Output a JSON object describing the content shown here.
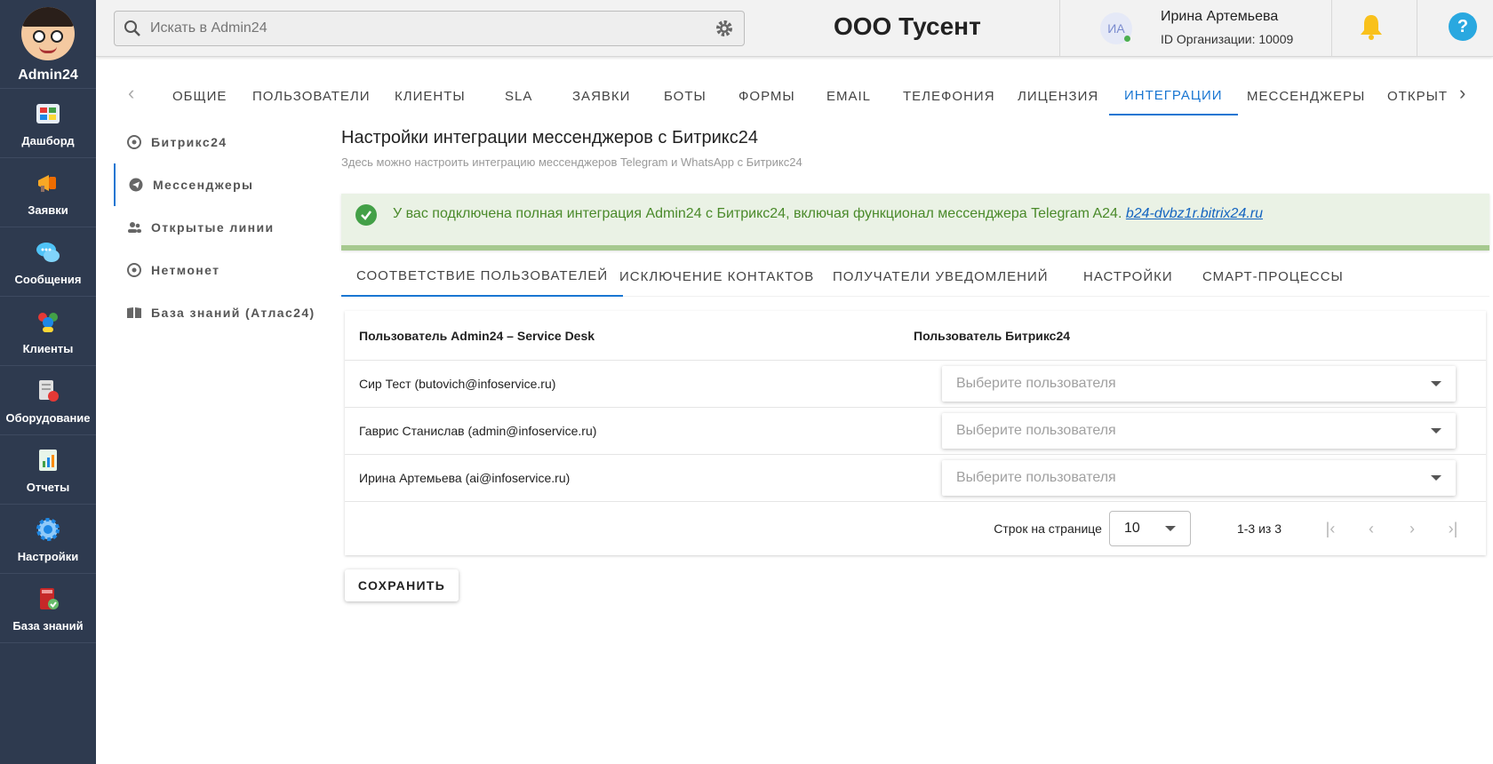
{
  "brand": {
    "name": "Admin24"
  },
  "sidebar": {
    "items": [
      {
        "label": "Дашборд",
        "icon": "dashboard-icon"
      },
      {
        "label": "Заявки",
        "icon": "megaphone-icon"
      },
      {
        "label": "Сообщения",
        "icon": "chat-bubbles-icon"
      },
      {
        "label": "Клиенты",
        "icon": "people-icon"
      },
      {
        "label": "Оборудование",
        "icon": "equipment-icon"
      },
      {
        "label": "Отчеты",
        "icon": "report-icon"
      },
      {
        "label": "Настройки",
        "icon": "gear-icon"
      },
      {
        "label": "База знаний",
        "icon": "book-icon"
      }
    ]
  },
  "header": {
    "search_placeholder": "Искать в Admin24",
    "org_title": "ООО Тусент",
    "user_initials": "ИА",
    "user_name": "Ирина Артемьева",
    "org_id": "ID Организации: 10009"
  },
  "main_tabs": [
    "Общие",
    "Пользователи",
    "Клиенты",
    "SLA",
    "Заявки",
    "Боты",
    "Формы",
    "Email",
    "Телефония",
    "Лицензия",
    "Интеграции",
    "Мессенджеры",
    "Открыт"
  ],
  "main_tabs_active": "Интеграции",
  "subnav": [
    {
      "label": "Битрикс24",
      "icon": "bitrix-icon"
    },
    {
      "label": "Мессенджеры",
      "icon": "telegram-icon"
    },
    {
      "label": "Открытые линии",
      "icon": "group-icon"
    },
    {
      "label": "Нетмонет",
      "icon": "bitrix-icon"
    },
    {
      "label": "База знаний (Атлас24)",
      "icon": "book-open-icon"
    }
  ],
  "content": {
    "title": "Настройки интеграции мессенджеров с Битрикс24",
    "subtitle": "Здесь можно настроить интеграцию мессенджеров Telegram и WhatsApp с Битрикс24",
    "alert_text": "У вас подключена полная интеграция Admin24 с Битрикс24, включая функционал мессенджера Telegram A24.",
    "alert_link": "b24-dvbz1r.bitrix24.ru",
    "sub_tabs": [
      "Соответствие пользователей",
      "Исключение контактов",
      "Получатели уведомлений",
      "Настройки",
      "Смарт-процессы"
    ],
    "table": {
      "col1": "Пользователь Admin24 – Service Desk",
      "col2": "Пользователь Битрикс24",
      "rows": [
        {
          "user": "Сир Тест (butovich@infoservice.ru)",
          "select": "Выберите пользователя"
        },
        {
          "user": "Гаврис Станислав (admin@infoservice.ru)",
          "select": "Выберите пользователя"
        },
        {
          "user": "Ирина Артемьева (ai@infoservice.ru)",
          "select": "Выберите пользователя"
        }
      ],
      "rows_per_page_label": "Строк на странице",
      "rows_per_page": "10",
      "range": "1-3 из 3"
    },
    "save_label": "Сохранить"
  },
  "colors": {
    "sidebar_bg": "#2e3a4f",
    "accent": "#1976d2",
    "success": "#43a047",
    "alert_bg": "#eaf2e5"
  }
}
